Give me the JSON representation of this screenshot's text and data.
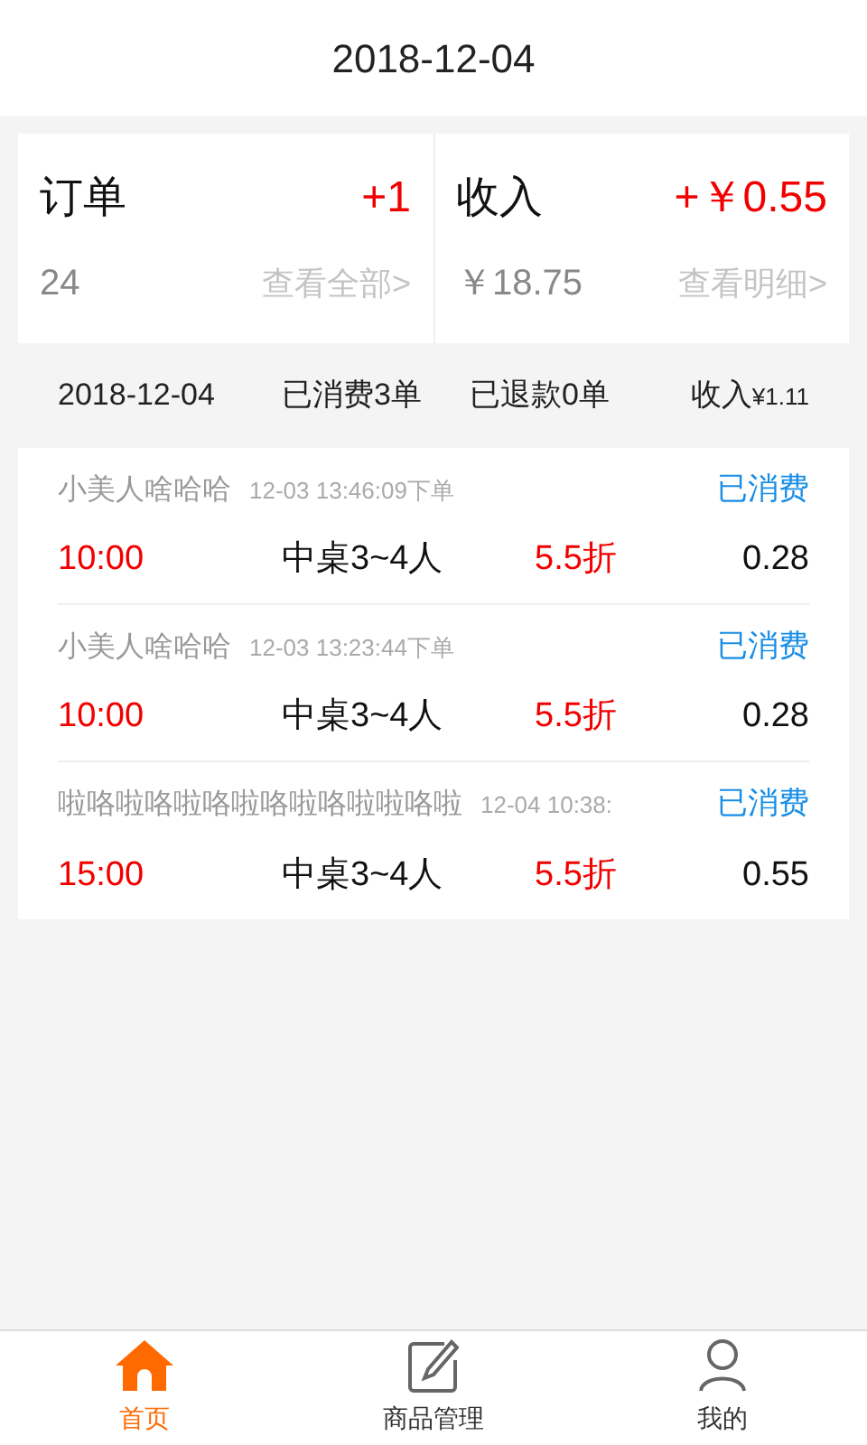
{
  "header": {
    "title": "2018-12-04"
  },
  "summary": [
    {
      "label": "订单",
      "delta": "+1",
      "value": "24",
      "link": "查看全部>"
    },
    {
      "label": "收入",
      "delta": "+￥0.55",
      "value": "￥18.75",
      "link": "查看明细>"
    }
  ],
  "day_bar": {
    "date": "2018-12-04",
    "consumed": "已消费3单",
    "refunded": "已退款0单",
    "income_label": "收入",
    "income_value": "¥1.11"
  },
  "orders": [
    {
      "name": "小美人啥哈哈",
      "time": "12-03 13:46:09下单",
      "status": "已消费",
      "slot": "10:00",
      "table": "中桌3~4人",
      "discount": "5.5折",
      "amount": "0.28"
    },
    {
      "name": "小美人啥哈哈",
      "time": "12-03 13:23:44下单",
      "status": "已消费",
      "slot": "10:00",
      "table": "中桌3~4人",
      "discount": "5.5折",
      "amount": "0.28"
    },
    {
      "name": "啦咯啦咯啦咯啦咯啦咯啦啦咯啦",
      "time": "12-04 10:38:",
      "status": "已消费",
      "slot": "15:00",
      "table": "中桌3~4人",
      "discount": "5.5折",
      "amount": "0.55"
    }
  ],
  "tabs": [
    {
      "kind": "home",
      "label": "首页",
      "selected": true
    },
    {
      "kind": "edit",
      "label": "商品管理",
      "selected": false
    },
    {
      "kind": "user",
      "label": "我的",
      "selected": false
    }
  ]
}
